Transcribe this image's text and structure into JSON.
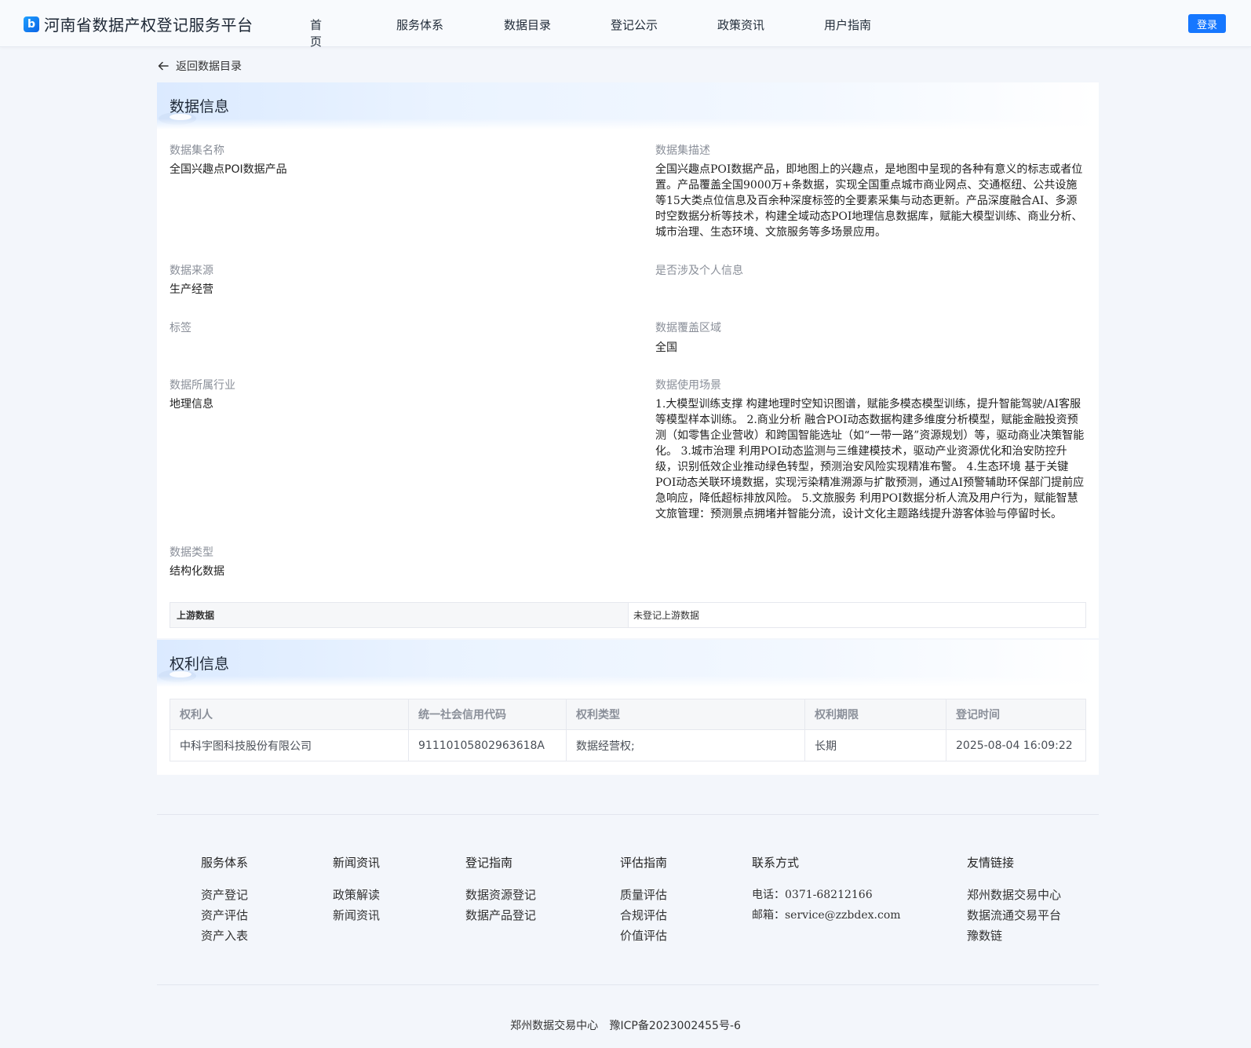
{
  "header": {
    "logo_glyph": "b",
    "site_title": "河南省数据产权登记服务平台",
    "nav": [
      "首页",
      "服务体系",
      "数据目录",
      "登记公示",
      "政策资讯",
      "用户指南"
    ],
    "login_label": "登录"
  },
  "back": {
    "label": "返回数据目录"
  },
  "data_info": {
    "title": "数据信息",
    "fields": {
      "name": {
        "label": "数据集名称",
        "value": "全国兴趣点POI数据产品"
      },
      "description": {
        "label": "数据集描述",
        "value": "全国兴趣点POI数据产品，即地图上的兴趣点，是地图中呈现的各种有意义的标志或者位置。产品覆盖全国9000万+条数据，实现全国重点城市商业网点、交通枢纽、公共设施等15大类点位信息及百余种深度标签的全要素采集与动态更新。产品深度融合AI、多源时空数据分析等技术，构建全域动态POI地理信息数据库，赋能大模型训练、商业分析、城市治理、生态环境、文旅服务等多场景应用。"
      },
      "source": {
        "label": "数据来源",
        "value": "生产经营"
      },
      "personal_info": {
        "label": "是否涉及个人信息",
        "value": ""
      },
      "tags": {
        "label": "标签",
        "value": ""
      },
      "coverage": {
        "label": "数据覆盖区域",
        "value": "全国"
      },
      "industry": {
        "label": "数据所属行业",
        "value": "地理信息"
      },
      "scenarios": {
        "label": "数据使用场景",
        "value": "1.大模型训练支撑 构建地理时空知识图谱，赋能多模态模型训练，提升智能驾驶/AI客服等模型样本训练。 2.商业分析 融合POI动态数据构建多维度分析模型，赋能金融投资预测（如零售企业营收）和跨国智能选址（如“一带一路”资源规划）等，驱动商业决策智能化。 3.城市治理 利用POI动态监测与三维建模技术，驱动产业资源优化和治安防控升级，识别低效企业推动绿色转型，预测治安风险实现精准布警。 4.生态环境 基于关键POI动态关联环境数据，实现污染精准溯源与扩散预测，通过AI预警辅助环保部门提前应急响应，降低超标排放风险。 5.文旅服务 利用POI数据分析人流及用户行为，赋能智慧文旅管理：预测景点拥堵并智能分流，设计文化主题路线提升游客体验与停留时长。"
      },
      "type": {
        "label": "数据类型",
        "value": "结构化数据"
      }
    },
    "upstream": {
      "label": "上游数据",
      "value": "未登记上游数据"
    }
  },
  "rights_info": {
    "title": "权利信息",
    "columns": [
      "权利人",
      "统一社会信用代码",
      "权利类型",
      "权利期限",
      "登记时间"
    ],
    "rows": [
      [
        "中科宇图科技股份有限公司",
        "91110105802963618A",
        "数据经营权;",
        "长期",
        "2025-08-04 16:09:22"
      ]
    ]
  },
  "footer": {
    "columns": [
      {
        "title": "服务体系",
        "links": [
          "资产登记",
          "资产评估",
          "资产入表"
        ]
      },
      {
        "title": "新闻资讯",
        "links": [
          "政策解读",
          "新闻资讯"
        ]
      },
      {
        "title": "登记指南",
        "links": [
          "数据资源登记",
          "数据产品登记"
        ]
      },
      {
        "title": "评估指南",
        "links": [
          "质量评估",
          "合规评估",
          "价值评估"
        ]
      },
      {
        "title": "联系方式",
        "links": [
          "电话：0371-68212166",
          "邮箱：service@zzbdex.com"
        ]
      },
      {
        "title": "友情链接",
        "links": [
          "郑州数据交易中心",
          "数据流通交易平台",
          "豫数链"
        ]
      }
    ],
    "org": "郑州数据交易中心",
    "icp": "豫ICP备2023002455号-6"
  },
  "colors": {
    "accent": "#1677ff",
    "page_bg": "#f3f6fb"
  }
}
